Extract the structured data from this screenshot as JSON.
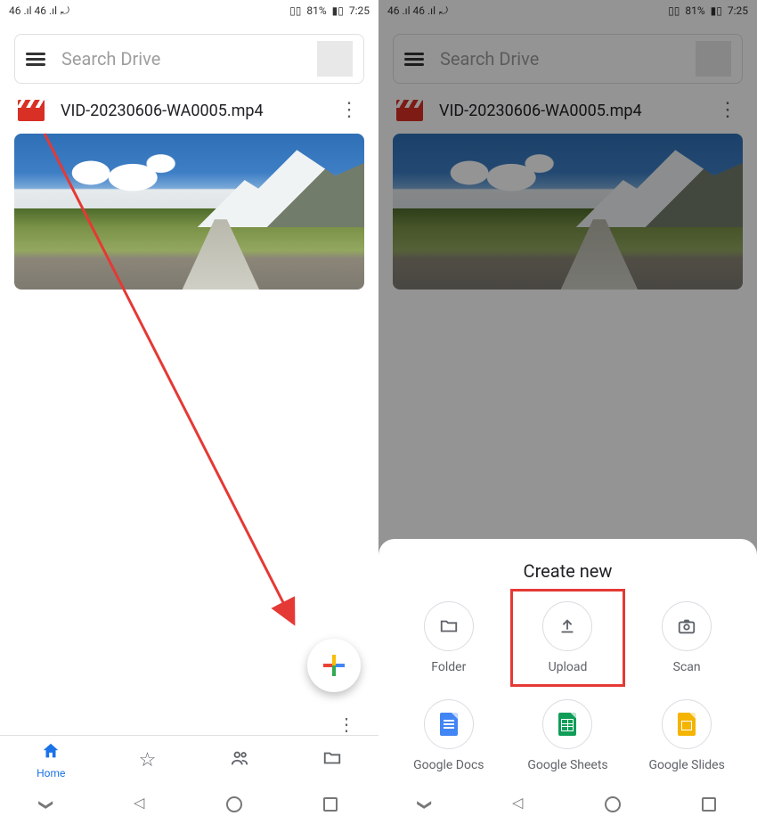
{
  "statusbar": {
    "signal_text": "46 .ıl 46 .ıl",
    "icons_right": "⌀ ⟳",
    "vibrate": "▯▯",
    "battery": "81%",
    "batt_icon": "▮▯",
    "time": "7:25"
  },
  "search": {
    "placeholder": "Search Drive"
  },
  "file": {
    "name": "VID-20230606-WA0005.mp4"
  },
  "nav": {
    "home": "Home"
  },
  "sheet": {
    "title": "Create new",
    "folder": "Folder",
    "upload": "Upload",
    "scan": "Scan",
    "docs": "Google Docs",
    "sheets": "Google Sheets",
    "slides": "Google Slides"
  }
}
